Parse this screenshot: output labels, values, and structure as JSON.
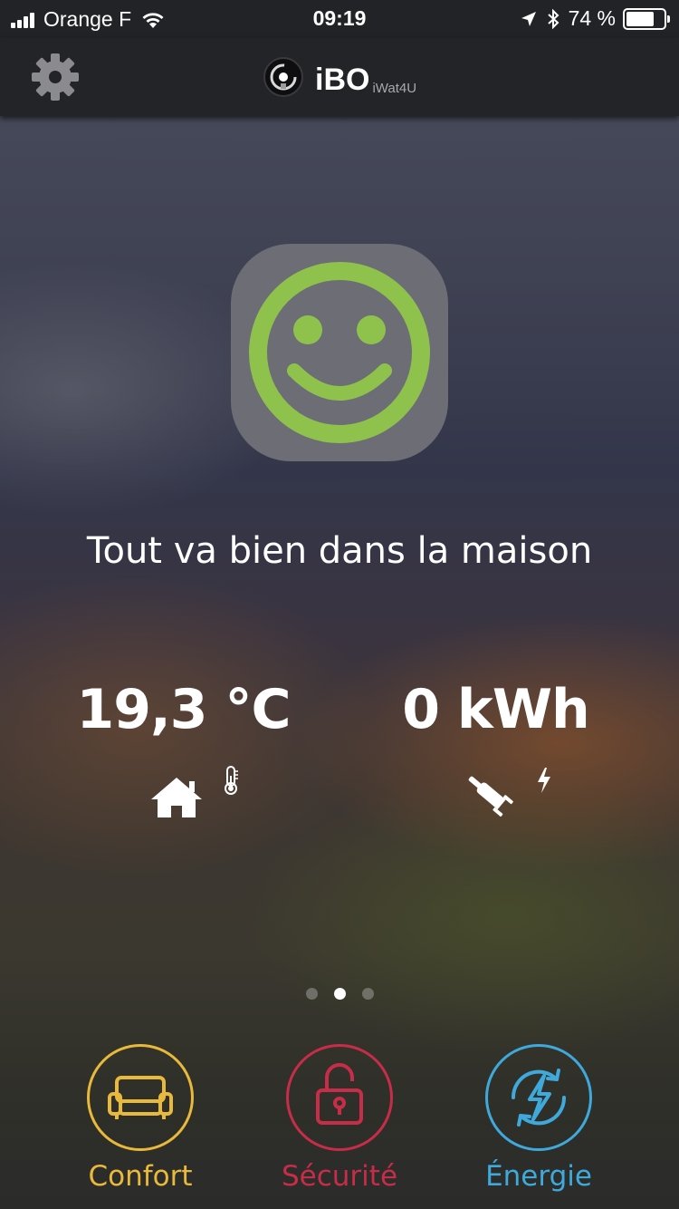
{
  "status_bar": {
    "carrier": "Orange F",
    "time": "09:19",
    "battery_text": "74 %",
    "battery_level": 0.74
  },
  "nav": {
    "app_name": "iBO",
    "app_subtitle": "iWat4U"
  },
  "home_status": {
    "mood": "happy",
    "mood_color": "#8fc24c",
    "message": "Tout va bien dans la maison"
  },
  "metrics": {
    "temperature": {
      "value": "19,3 °C",
      "icon": "house-icon"
    },
    "energy": {
      "value": "0 kWh",
      "icon": "plug-icon"
    }
  },
  "pager": {
    "count": 3,
    "active_index": 1
  },
  "tabs": [
    {
      "label": "Confort",
      "color": "#e8b93a",
      "icon": "armchair-icon"
    },
    {
      "label": "Sécurité",
      "color": "#c72c48",
      "icon": "unlocked-padlock-icon"
    },
    {
      "label": "Énergie",
      "color": "#3fa9dc",
      "icon": "lightning-cycle-icon"
    }
  ]
}
